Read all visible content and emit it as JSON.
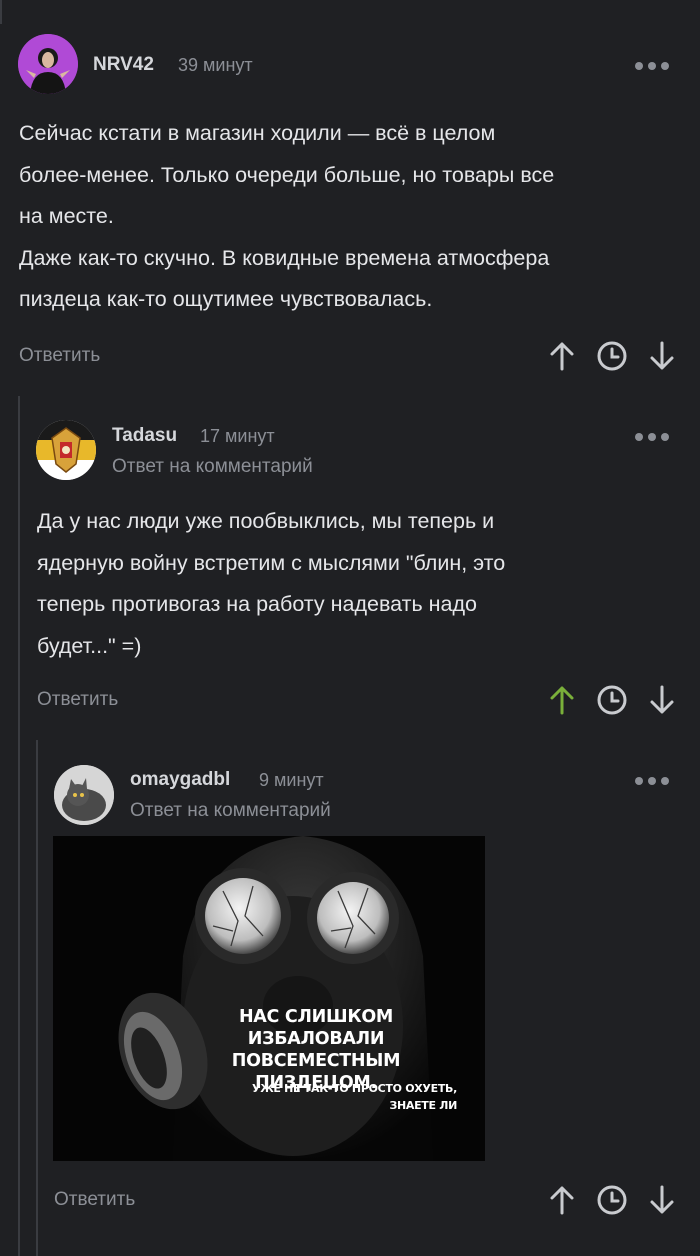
{
  "comments": [
    {
      "username": "NRV42",
      "time": "39 минут",
      "text": [
        "Сейчас кстати в магазин ходили — всё в целом",
        "более-менее. Только очереди больше, но товары все",
        "на месте.",
        "Даже как-то скучно. В ковидные времена атмосфера",
        "пиздеца как-то ощутимее чувствовалась."
      ],
      "reply_label": "Ответить"
    },
    {
      "username": "Tadasu",
      "time": "17 минут",
      "reply_to": "Ответ на комментарий",
      "text": [
        "Да у нас люди уже пообвыклись, мы теперь и",
        "ядерную войну встретим с мыслями \"блин, это",
        "теперь противогаз на работу надевать надо",
        "будет...\" =)"
      ],
      "reply_label": "Ответить",
      "upvoted": true
    },
    {
      "username": "omaygadbl",
      "time": "9 минут",
      "reply_to": "Ответ на комментарий",
      "image_text": {
        "line1": "НАС СЛИШКОМ ИЗБАЛОВАЛИ",
        "line2": "ПОВСЕМЕСТНЫМ ПИЗДЕЦОМ.",
        "line3": "УЖЕ НЕ ТАК-ТО ПРОСТО ОХУЕТЬ,",
        "line4": "ЗНАЕТЕ ЛИ"
      },
      "reply_label": "Ответить"
    }
  ],
  "colors": {
    "background": "#1f2023",
    "upvote_active": "#7ab03a",
    "icon": "#c9cbcf"
  }
}
